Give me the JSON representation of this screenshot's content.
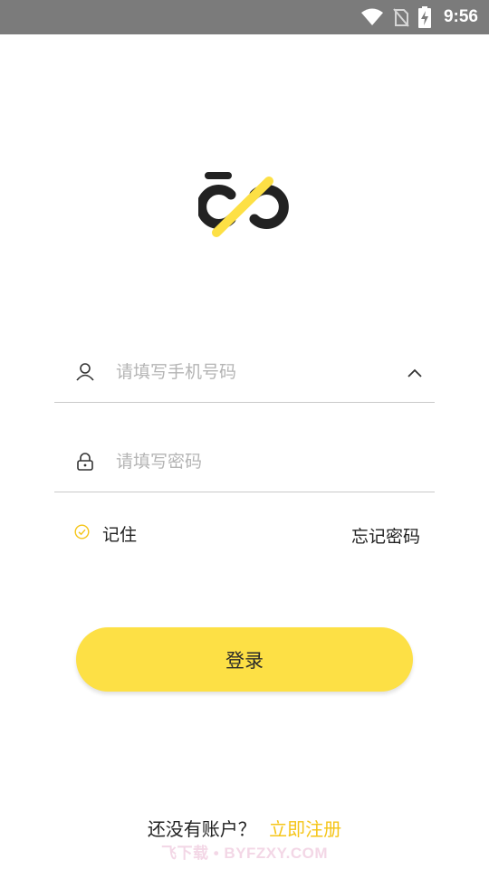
{
  "status_bar": {
    "time": "9:56",
    "icons": [
      "wifi-icon",
      "no-sim-icon",
      "battery-charging-icon"
    ],
    "background": "#7b7b7b"
  },
  "logo": {
    "colors": {
      "dark": "#222222",
      "accent": "#fde045"
    }
  },
  "login_form": {
    "phone": {
      "placeholder": "请填写手机号码",
      "value": "",
      "icon": "user-icon",
      "toggle_icon": "chevron-up-icon"
    },
    "password": {
      "placeholder": "请填写密码",
      "value": "",
      "icon": "lock-icon"
    },
    "remember": {
      "label": "记住",
      "icon": "check-circle-icon",
      "checked": true
    },
    "forgot_password": "忘记密码",
    "login_button": "登录"
  },
  "footer": {
    "prompt": "还没有账户？",
    "signup_link": "立即注册",
    "watermark": "飞下载 • BYFZXY.COM"
  },
  "colors": {
    "accent": "#fde045",
    "link": "#f5c518",
    "text": "#222222",
    "placeholder": "#b4b4b4",
    "divider": "#c9c9c9"
  }
}
